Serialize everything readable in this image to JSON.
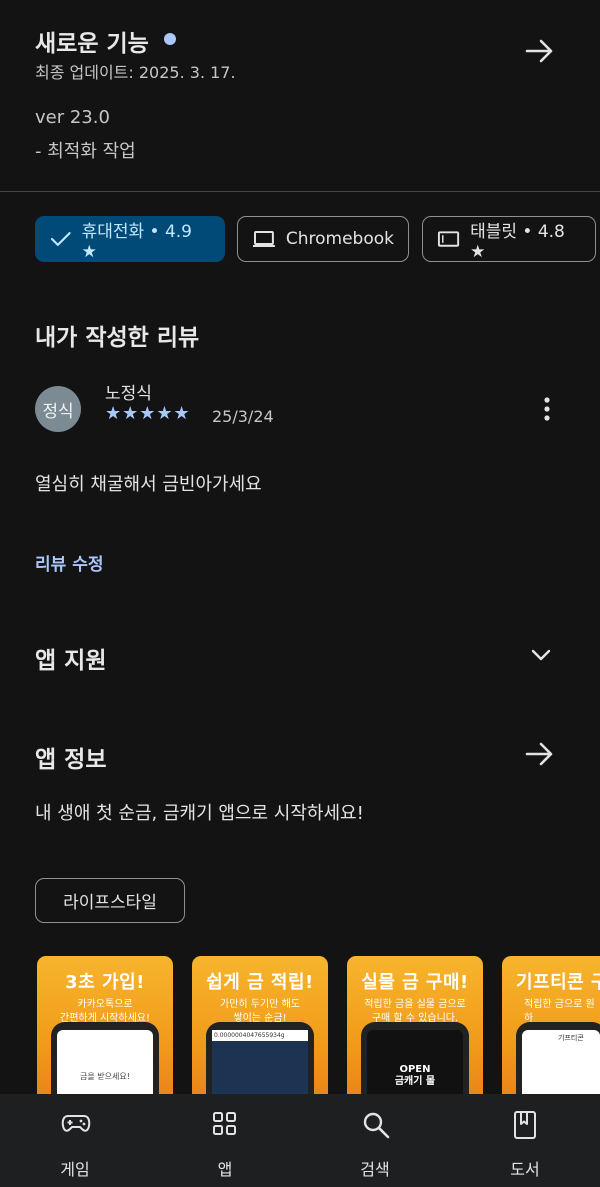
{
  "whats_new": {
    "title": "새로운 기능",
    "last_updated": "최종 업데이트: 2025. 3. 17.",
    "version": "ver 23.0",
    "note": "- 최적화 작업"
  },
  "device_chips": [
    {
      "label": "휴대전화 • 4.9 ★",
      "icon": "check-icon",
      "active": true
    },
    {
      "label": "Chromebook",
      "icon": "laptop-icon",
      "active": false
    },
    {
      "label": "태블릿 • 4.8 ★",
      "icon": "tablet-icon",
      "active": false
    }
  ],
  "my_review": {
    "heading": "내가 작성한 리뷰",
    "avatar_text": "정식",
    "author": "노정식",
    "stars": "★★★★★",
    "rating": 5,
    "date": "25/3/24",
    "text": "열심히 채굴해서 금빈아가세요",
    "edit_label": "리뷰 수정"
  },
  "app_support": {
    "heading": "앱 지원"
  },
  "app_info": {
    "heading": "앱 정보",
    "description": "내 생애 첫 순금, 금캐기 앱으로 시작하세요!",
    "category": "라이프스타일"
  },
  "screenshots": [
    {
      "headline": "3초 가입!",
      "sub": "카카오톡으로\n간편하게 시작하세요!",
      "screen_text": "금을 받으세요!"
    },
    {
      "headline": "쉽게 금 적립!",
      "sub": "가만히 두기만 해도\n쌓이는 순금!",
      "screen_text": "0.0000004047655934g"
    },
    {
      "headline": "실물 금 구매!",
      "sub": "적립한 금을 실물 금으로\n구매 할 수 있습니다.",
      "screen_text": "OPEN\n금캐기 몰"
    },
    {
      "headline": "기프티콘 구",
      "sub": "적립한 금으로 원하\n기프티콘을 구매하세",
      "screen_text": "기프티콘"
    }
  ],
  "bottom_nav": [
    {
      "label": "게임",
      "icon": "gamepad-icon"
    },
    {
      "label": "앱",
      "icon": "apps-grid-icon"
    },
    {
      "label": "검색",
      "icon": "search-icon"
    },
    {
      "label": "도서",
      "icon": "bookmark-book-icon"
    }
  ],
  "colors": {
    "background": "#131314",
    "accent_blue": "#a8c7fa",
    "chip_active_bg": "#004a77",
    "star_color": "#a8c7fa",
    "screenshot_orange": "#f5a623"
  }
}
